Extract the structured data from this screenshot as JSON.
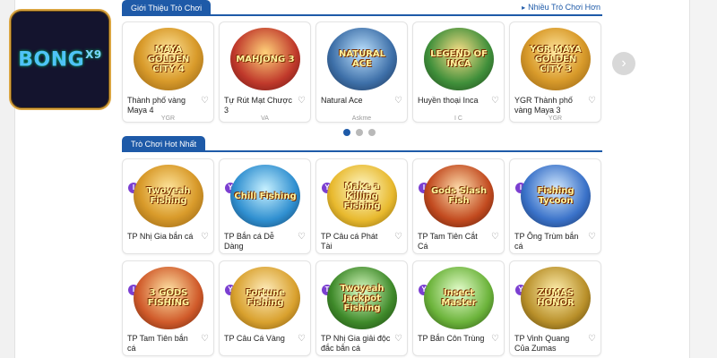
{
  "logo": {
    "text": "BONG",
    "sup": "X9"
  },
  "intro_section": {
    "title": "Giới Thiệu Trò Chơi",
    "more_label": "Nhiều Trò Chơi Hơn",
    "games": [
      {
        "name": "Thành phố vàng Maya 4",
        "provider": "YGR",
        "art": "MAYA GOLDEN CITY 4",
        "icon": "maya-golden-city-art"
      },
      {
        "name": "Tự Rút Mạt Chược 3",
        "provider": "VA",
        "art": "MAHJONG 3",
        "icon": "mahjong-art"
      },
      {
        "name": "Natural Ace",
        "provider": "Askme",
        "art": "NATURAL ACE",
        "icon": "natural-ace-art"
      },
      {
        "name": "Huyền thoại Inca",
        "provider": "I C",
        "art": "LEGEND OF INCA",
        "icon": "legend-of-inca-art"
      },
      {
        "name": "YGR Thành phố vàng Maya 3",
        "provider": "YGR",
        "art": "YGR MAYA GOLDEN CITY 3",
        "icon": "maya-golden-city-3-art"
      }
    ]
  },
  "hot_section": {
    "title": "Trò Chơi Hot Nhất",
    "games_row1": [
      {
        "name": "TP Nhị Gia bắn cá",
        "art": "Twoyeah Fishing",
        "badge": "I"
      },
      {
        "name": "TP Bắn cá Dễ Dàng",
        "art": "Chill Fishing",
        "badge": "Y"
      },
      {
        "name": "TP Câu cá Phát Tài",
        "art": "Make a Killing Fishing",
        "badge": "Y"
      },
      {
        "name": "TP Tam Tiên Cắt Cá",
        "art": "Gods Slash Fish",
        "badge": "I"
      },
      {
        "name": "TP Ông Trùm bắn cá",
        "art": "Fishing Tycoon",
        "badge": "I"
      }
    ],
    "games_row2": [
      {
        "name": "TP Tam Tiên bắn cá",
        "art": "3 GODS FISHING",
        "badge": "I"
      },
      {
        "name": "TP Câu Cá Vàng",
        "art": "Fortune Fishing",
        "badge": "Y"
      },
      {
        "name": "TP Nhị Gia giải độc đắc bắn cá",
        "art": "Twoyeah Jackpot Fishing",
        "badge": "T"
      },
      {
        "name": "TP Bắn Côn Trùng",
        "art": "Insect Master",
        "badge": "Y"
      },
      {
        "name": "TP Vinh Quang Của Zumas",
        "art": "ZUMAS HONOR",
        "badge": "Y"
      }
    ]
  },
  "carousel": {
    "next_glyph": "›",
    "active_dot": 0,
    "dot_count": 3
  },
  "colors": {
    "accent": "#1e5aa8",
    "gold": "#d99b2b"
  }
}
